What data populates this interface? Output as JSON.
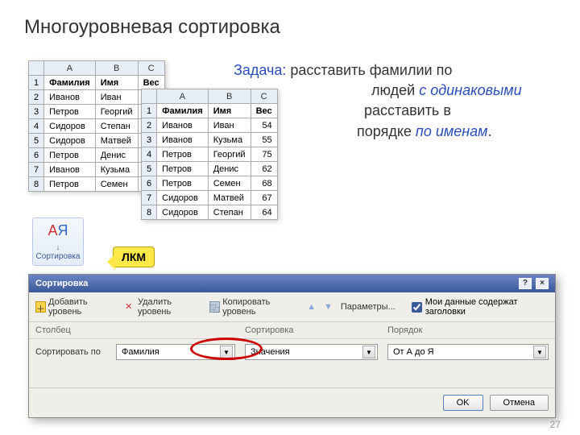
{
  "title": "Многоуровневая сортировка",
  "task": {
    "label": "Задача:",
    "part1": " расставить фамилии по",
    "part2_hidden_l1": "",
    "part2b": "людей",
    "italic1": "с одинаковыми",
    "part3_hidden": "",
    "part3b": "расставить в",
    "part4_hidden": "",
    "part4b": "порядке",
    "italic2": "по именам",
    "dot": "."
  },
  "table1": {
    "cols": [
      "A",
      "B",
      "C"
    ],
    "headers": [
      "Фамилия",
      "Имя",
      "Вес"
    ],
    "rows": [
      [
        "Иванов",
        "Иван",
        ""
      ],
      [
        "Петров",
        "Георгий",
        ""
      ],
      [
        "Сидоров",
        "Степан",
        ""
      ],
      [
        "Сидоров",
        "Матвей",
        ""
      ],
      [
        "Петров",
        "Денис",
        ""
      ],
      [
        "Иванов",
        "Кузьма",
        ""
      ],
      [
        "Петров",
        "Семен",
        ""
      ]
    ]
  },
  "table2": {
    "cols": [
      "A",
      "B",
      "C"
    ],
    "headers": [
      "Фамилия",
      "Имя",
      "Вес"
    ],
    "rows": [
      [
        "Иванов",
        "Иван",
        "54"
      ],
      [
        "Иванов",
        "Кузьма",
        "55"
      ],
      [
        "Петров",
        "Георгий",
        "75"
      ],
      [
        "Петров",
        "Денис",
        "62"
      ],
      [
        "Петров",
        "Семен",
        "68"
      ],
      [
        "Сидоров",
        "Матвей",
        "67"
      ],
      [
        "Сидоров",
        "Степан",
        "64"
      ]
    ]
  },
  "sort_button": {
    "label": "Сортировка",
    "glyph": "A↓Я"
  },
  "callout": "ЛКМ",
  "dialog": {
    "title": "Сортировка",
    "toolbar": {
      "add": "Добавить уровень",
      "del": "Удалить уровень",
      "copy": "Копировать уровень",
      "params": "Параметры...",
      "chk": "Мои данные содержат заголовки"
    },
    "headers": {
      "col": "Столбец",
      "sort": "Сортировка",
      "order": "Порядок"
    },
    "row": {
      "label": "Сортировать по",
      "field": "Фамилия",
      "sortby": "Значения",
      "order": "От А до Я"
    },
    "buttons": {
      "ok": "OK",
      "cancel": "Отмена"
    }
  },
  "page": "27"
}
